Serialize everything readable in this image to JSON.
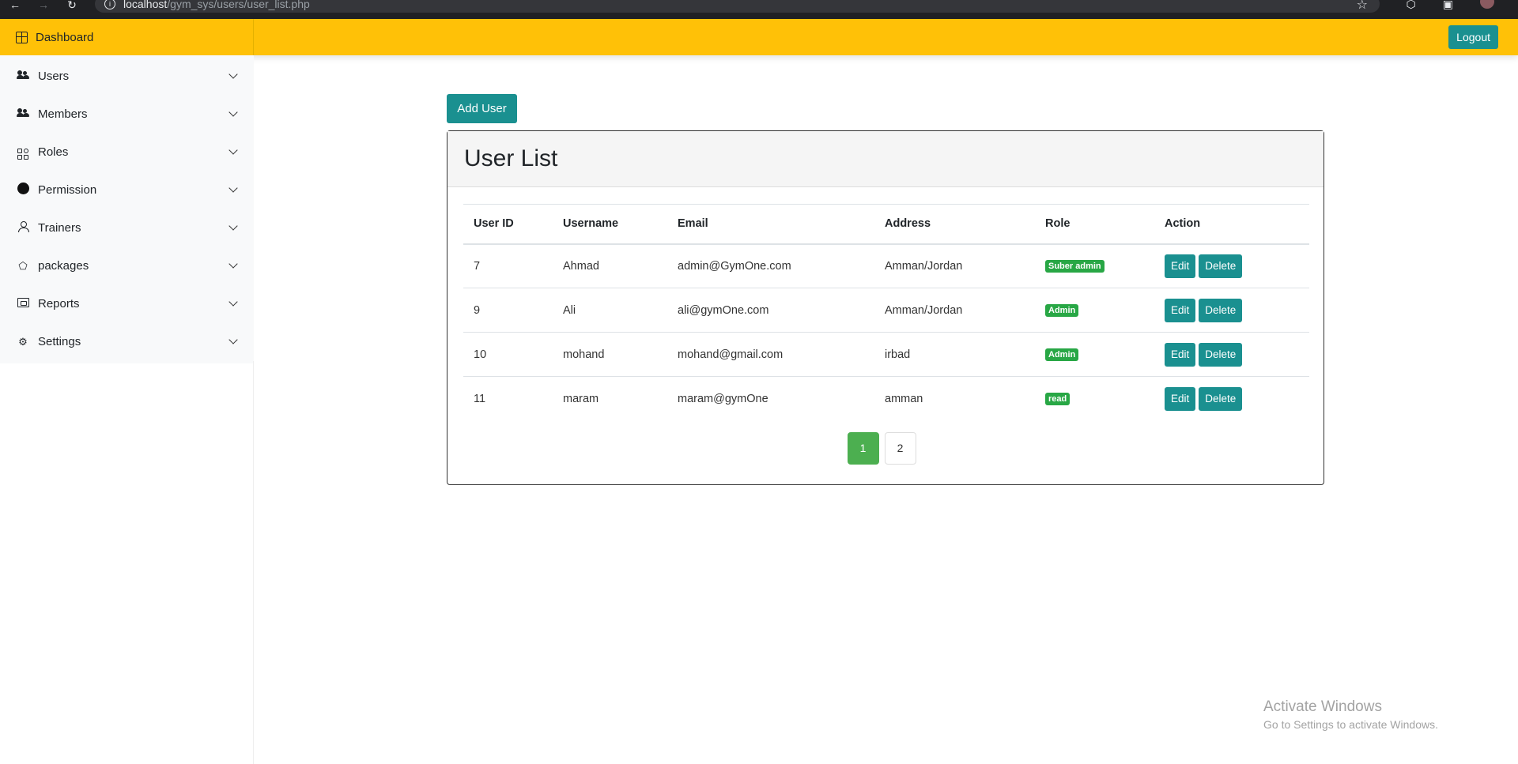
{
  "browser": {
    "url_host": "localhost",
    "url_path": "/gym_sys/users/user_list.php"
  },
  "topbar": {
    "logout_label": "Logout"
  },
  "sidebar": {
    "dashboard_label": "Dashboard",
    "items": [
      {
        "label": "Users",
        "icon": "users-icon"
      },
      {
        "label": "Members",
        "icon": "members-icon"
      },
      {
        "label": "Roles",
        "icon": "roles-icon"
      },
      {
        "label": "Permission",
        "icon": "permission-icon"
      },
      {
        "label": "Trainers",
        "icon": "person-icon"
      },
      {
        "label": "packages",
        "icon": "pentagon-icon"
      },
      {
        "label": "Reports",
        "icon": "folder-icon"
      },
      {
        "label": "Settings",
        "icon": "gear-icon"
      }
    ]
  },
  "main": {
    "add_user_label": "Add User",
    "card_title": "User List",
    "table": {
      "headers": [
        "User ID",
        "Username",
        "Email",
        "Address",
        "Role",
        "Action"
      ],
      "rows": [
        {
          "id": "7",
          "username": "Ahmad",
          "email": "admin@GymOne.com",
          "address": "Amman/Jordan",
          "role": "Suber admin"
        },
        {
          "id": "9",
          "username": "Ali",
          "email": "ali@gymOne.com",
          "address": "Amman/Jordan",
          "role": "Admin"
        },
        {
          "id": "10",
          "username": "mohand",
          "email": "mohand@gmail.com",
          "address": "irbad",
          "role": "Admin"
        },
        {
          "id": "11",
          "username": "maram",
          "email": "maram@gymOne",
          "address": "amman",
          "role": "read"
        }
      ],
      "edit_label": "Edit",
      "delete_label": "Delete"
    },
    "pagination": {
      "pages": [
        "1",
        "2"
      ],
      "current": "1"
    }
  },
  "watermark": {
    "title": "Activate Windows",
    "subtitle": "Go to Settings to activate Windows."
  },
  "colors": {
    "accent_yellow": "#ffc107",
    "button_teal": "#1a9090",
    "badge_green": "#28a745",
    "pagination_active": "#4caf50"
  }
}
